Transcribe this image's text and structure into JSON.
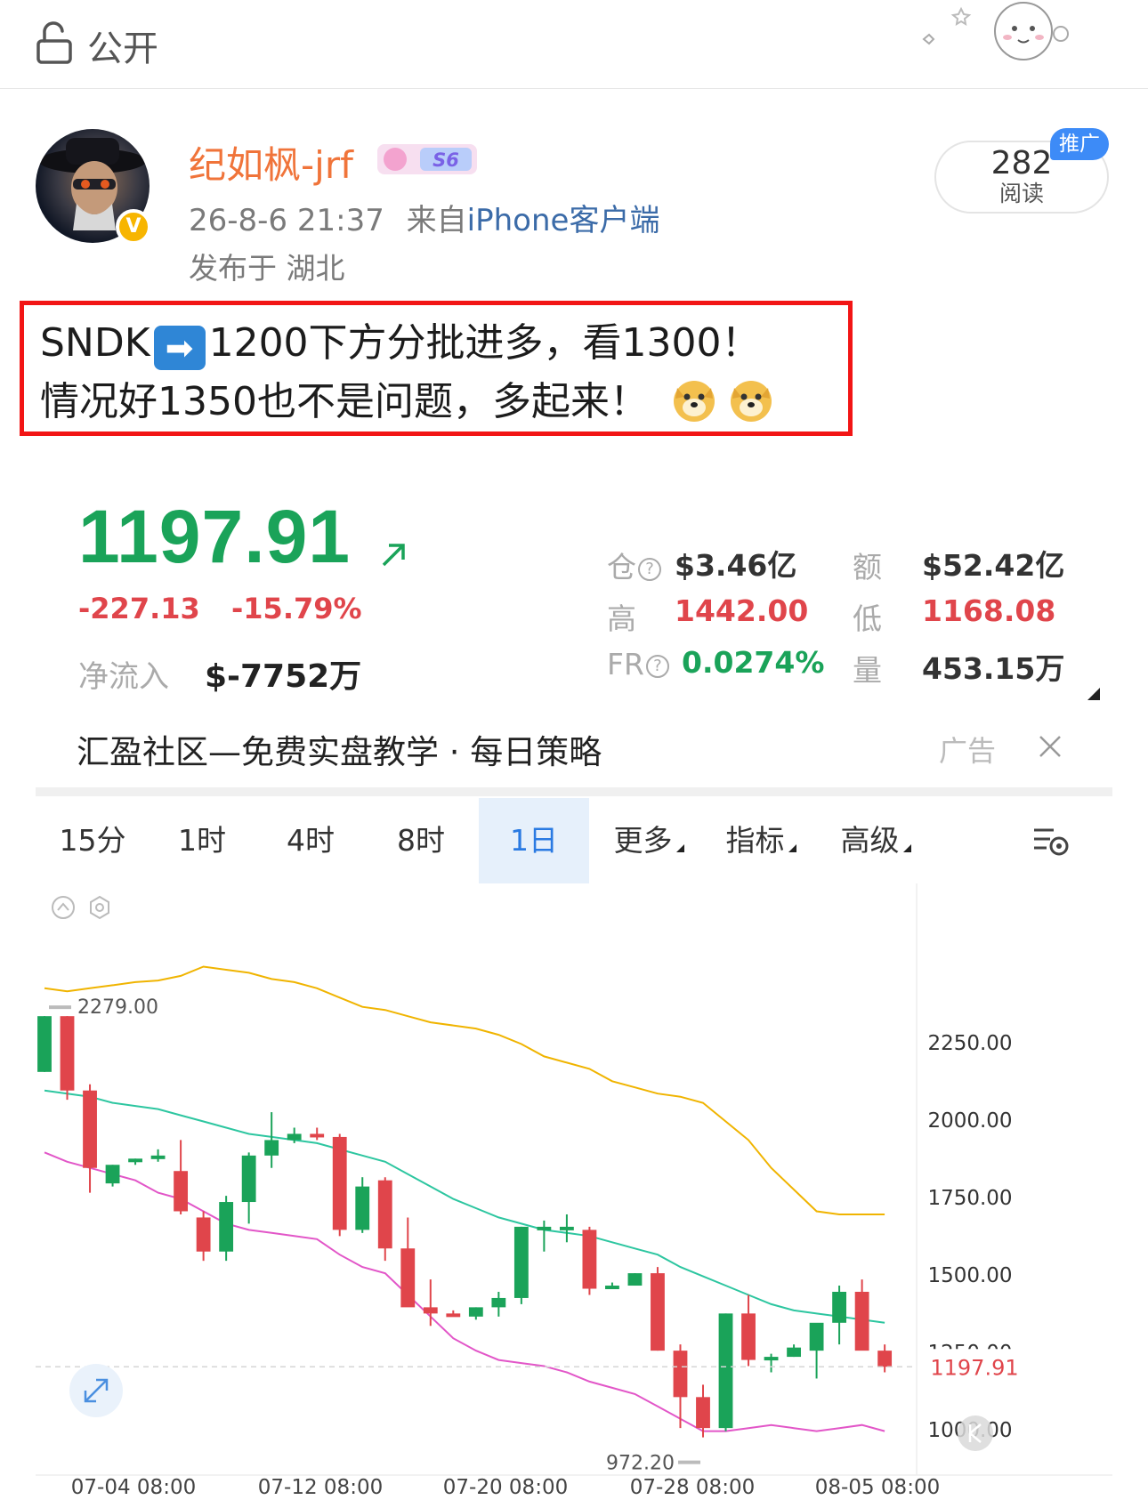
{
  "topbar": {
    "visibility": "公开",
    "lock_icon": "lock-open-icon",
    "decor_icon": "cute-bunny-sticker"
  },
  "post": {
    "username": "纪如枫-jrf",
    "level_badge": "S6",
    "timestamp": "26-8-6 21:37",
    "source_prefix": "来自",
    "source_client": "iPhone客户端",
    "location": "发布于 湖北",
    "reads_count": "282",
    "reads_label": "阅读",
    "promo_label": "推广",
    "verified_badge": "V",
    "content_line1_a": "SNDK",
    "content_line1_b": "1200下方分批进多，看1300！",
    "content_line2": "情况好1350也不是问题，多起来！",
    "arrow_emoji": "➡"
  },
  "quote": {
    "price": "1197.91",
    "change": "-227.13",
    "change_pct": "-15.79%",
    "net_inflow_label": "净流入",
    "net_inflow_value": "$-7752万",
    "stats": {
      "cang_label": "仓",
      "cang_value": "$3.46亿",
      "e_label": "额",
      "e_value": "$52.42亿",
      "high_label": "高",
      "high_value": "1442.00",
      "low_label": "低",
      "low_value": "1168.08",
      "fr_label": "FR",
      "fr_value": "0.0274%",
      "vol_label": "量",
      "vol_value": "453.15万"
    },
    "colors": {
      "up": "#1aa359",
      "down": "#e0454b"
    }
  },
  "ad": {
    "text": "汇盈社区—免费实盘教学 · 每日策略",
    "label": "广告"
  },
  "tabs": [
    {
      "label": "15分"
    },
    {
      "label": "1时"
    },
    {
      "label": "4时"
    },
    {
      "label": "8时"
    },
    {
      "label": "1日",
      "active": true
    },
    {
      "label": "更多"
    },
    {
      "label": "指标"
    },
    {
      "label": "高级"
    }
  ],
  "chart_data": {
    "type": "candlestick",
    "y_ticks": [
      "2250.00",
      "2000.00",
      "1750.00",
      "1500.00",
      "1250.00",
      "1000.00"
    ],
    "ylim": [
      920,
      2500
    ],
    "x_ticks": [
      "07-04 08:00",
      "07-12 08:00",
      "07-20 08:00",
      "07-28 08:00",
      "08-05 08:00"
    ],
    "last_price_label": "1197.91",
    "max_label": "2279.00",
    "min_label": "972.20",
    "candles": [
      [
        2150,
        2330,
        2150,
        2330
      ],
      [
        2330,
        2330,
        2060,
        2090
      ],
      [
        2090,
        2110,
        1760,
        1840
      ],
      [
        1790,
        1850,
        1780,
        1850
      ],
      [
        1860,
        1870,
        1850,
        1870
      ],
      [
        1870,
        1900,
        1860,
        1880
      ],
      [
        1830,
        1930,
        1690,
        1700
      ],
      [
        1680,
        1700,
        1540,
        1570
      ],
      [
        1570,
        1750,
        1540,
        1730
      ],
      [
        1730,
        1890,
        1660,
        1880
      ],
      [
        1880,
        2020,
        1840,
        1930
      ],
      [
        1930,
        1970,
        1920,
        1950
      ],
      [
        1950,
        1970,
        1930,
        1940
      ],
      [
        1940,
        1950,
        1620,
        1640
      ],
      [
        1640,
        1810,
        1630,
        1780
      ],
      [
        1800,
        1810,
        1540,
        1580
      ],
      [
        1580,
        1680,
        1420,
        1390
      ],
      [
        1390,
        1480,
        1330,
        1370
      ],
      [
        1370,
        1380,
        1360,
        1360
      ],
      [
        1360,
        1390,
        1350,
        1390
      ],
      [
        1390,
        1440,
        1360,
        1420
      ],
      [
        1420,
        1650,
        1400,
        1650
      ],
      [
        1650,
        1670,
        1570,
        1650
      ],
      [
        1650,
        1690,
        1600,
        1650
      ],
      [
        1640,
        1650,
        1430,
        1450
      ],
      [
        1460,
        1470,
        1450,
        1460
      ],
      [
        1460,
        1500,
        1460,
        1500
      ],
      [
        1500,
        1520,
        1250,
        1250
      ],
      [
        1250,
        1270,
        1000,
        1100
      ],
      [
        1100,
        1140,
        970,
        1000
      ],
      [
        1000,
        1370,
        990,
        1370
      ],
      [
        1370,
        1430,
        1200,
        1220
      ],
      [
        1220,
        1240,
        1180,
        1230
      ],
      [
        1230,
        1270,
        1230,
        1260
      ],
      [
        1250,
        1330,
        1160,
        1340
      ],
      [
        1340,
        1460,
        1270,
        1440
      ],
      [
        1440,
        1480,
        1280,
        1250
      ],
      [
        1250,
        1270,
        1180,
        1198
      ]
    ],
    "series": [
      {
        "color": "#f0b400",
        "values": [
          2420,
          2410,
          2420,
          2430,
          2440,
          2445,
          2460,
          2490,
          2480,
          2470,
          2450,
          2440,
          2420,
          2390,
          2360,
          2350,
          2330,
          2310,
          2300,
          2290,
          2270,
          2240,
          2200,
          2180,
          2160,
          2120,
          2100,
          2080,
          2070,
          2050,
          1990,
          1930,
          1840,
          1770,
          1700,
          1690,
          1690,
          1690
        ]
      },
      {
        "color": "#2dc6a0",
        "values": [
          2090,
          2080,
          2070,
          2050,
          2040,
          2030,
          2010,
          1990,
          1970,
          1950,
          1940,
          1930,
          1920,
          1900,
          1880,
          1860,
          1820,
          1780,
          1740,
          1710,
          1680,
          1660,
          1640,
          1630,
          1620,
          1600,
          1580,
          1560,
          1520,
          1490,
          1460,
          1430,
          1400,
          1380,
          1370,
          1360,
          1350,
          1340
        ]
      },
      {
        "color": "#e256c8",
        "values": [
          1890,
          1860,
          1840,
          1820,
          1800,
          1760,
          1740,
          1700,
          1660,
          1640,
          1630,
          1620,
          1610,
          1560,
          1520,
          1500,
          1430,
          1360,
          1290,
          1250,
          1220,
          1210,
          1200,
          1180,
          1150,
          1130,
          1110,
          1070,
          1030,
          990,
          990,
          1000,
          1010,
          1000,
          990,
          1000,
          1010,
          990
        ]
      }
    ]
  }
}
